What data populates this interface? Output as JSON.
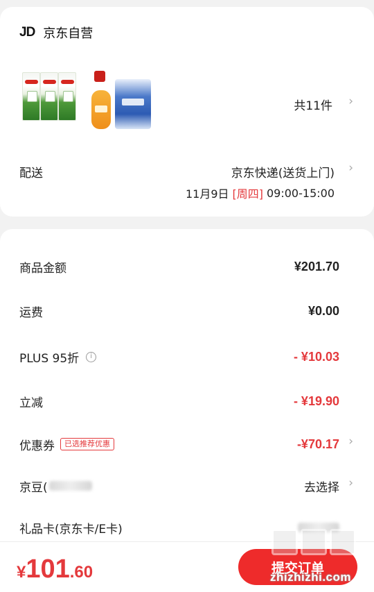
{
  "store": {
    "logo_text": "JD",
    "name": "京东自营",
    "item_count": "共11件"
  },
  "delivery": {
    "label": "配送",
    "method": "京东快递(送货上门)",
    "date": "11月9日",
    "weekday": "[周四]",
    "time": "09:00-15:00"
  },
  "price": {
    "goods_label": "商品金额",
    "goods_value": "¥201.70",
    "shipping_label": "运费",
    "shipping_value": "¥0.00",
    "plus_label": "PLUS 95折",
    "plus_value": "- ¥10.03",
    "instant_label": "立减",
    "instant_value": "- ¥19.90",
    "coupon_label": "优惠券",
    "coupon_badge": "已选推荐优惠",
    "coupon_value": "-¥70.17",
    "jingdou_label": "京豆(",
    "jingdou_action": "去选择",
    "giftcard_label": "礼品卡(京东卡/E卡)"
  },
  "bottom": {
    "currency": "¥",
    "total_int": "101",
    "total_dec": ".60",
    "submit_label": "提交订单"
  },
  "watermark": {
    "site": "zhizhizhi.com"
  },
  "colors": {
    "accent_red": "#e4393c",
    "button_red": "#ee2b2b",
    "background": "#f2f2f2"
  }
}
